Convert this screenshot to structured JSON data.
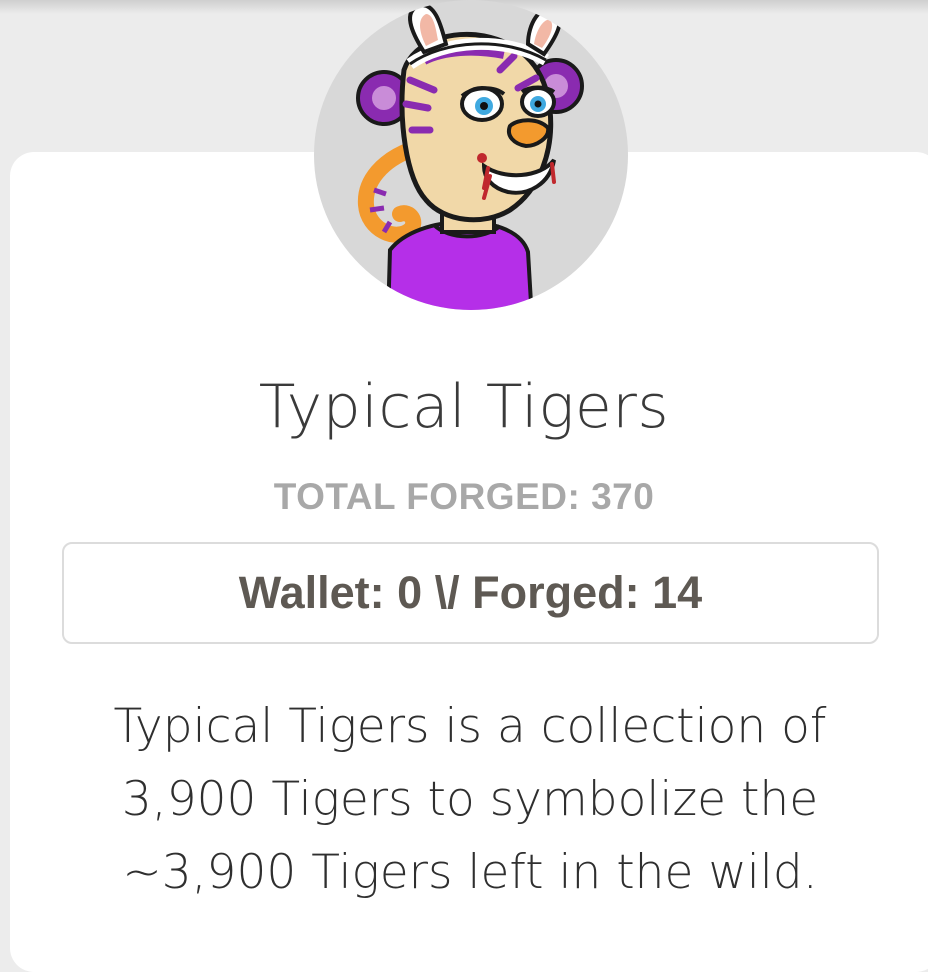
{
  "collection": {
    "name": "Typical Tigers",
    "total_forged_label": "TOTAL FORGED: 370",
    "wallet_label": "Wallet: 0",
    "separator": " \\/ ",
    "forged_label": "Forged: 14",
    "description": "Typical Tigers is a collection of 3,900 Tigers to symbolize the ~3,900 Tigers left in the wild."
  },
  "colors": {
    "page_background": "#ececec",
    "card_background": "#ffffff",
    "avatar_background": "#d8d8d8",
    "tiger_fur": "#f1d8a8",
    "tiger_stripes": "#8a2bb0",
    "shirt": "#b52fe8",
    "accent_orange": "#f39a2e"
  },
  "icons": {
    "avatar": "tiger-avatar-icon"
  }
}
